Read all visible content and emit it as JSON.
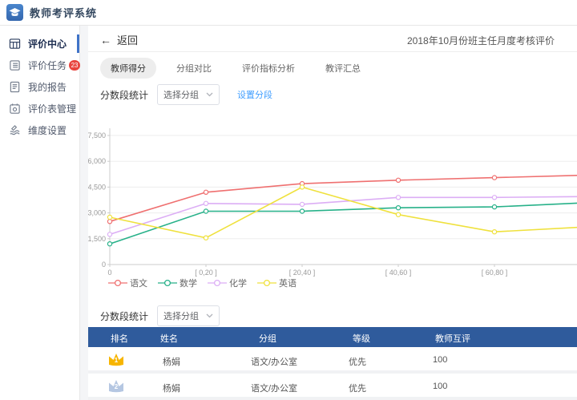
{
  "header": {
    "app_title": "教师考评系统",
    "logo_icon": "graduation-cap-icon"
  },
  "sidebar": {
    "items": [
      {
        "label": "评价中心",
        "icon": "grid-icon",
        "active": true
      },
      {
        "label": "评价任务",
        "icon": "task-list-icon",
        "badge": "23"
      },
      {
        "label": "我的报告",
        "icon": "report-icon"
      },
      {
        "label": "评价表管理",
        "icon": "form-manage-icon"
      },
      {
        "label": "维度设置",
        "icon": "dimension-icon"
      }
    ]
  },
  "toolbar": {
    "back_label": "返回",
    "page_title": "2018年10月份班主任月度考核评价"
  },
  "tabs": [
    {
      "label": "教师得分",
      "active": true
    },
    {
      "label": "分组对比",
      "active": false
    },
    {
      "label": "评价指标分析",
      "active": false
    },
    {
      "label": "教评汇总",
      "active": false
    }
  ],
  "score_section_top": {
    "label": "分数段统计",
    "group_select_value": "选择分组",
    "set_segment_label": "设置分段"
  },
  "score_section_bottom": {
    "label": "分数段统计",
    "group_select_value": "选择分组"
  },
  "chart_data": {
    "type": "line",
    "x_labels": [
      "0",
      "[ 0,20 ]",
      "[ 20,40 ]",
      "[ 40,60 ]",
      "[ 60,80 ]"
    ],
    "y_ticks": [
      "0",
      "1,500",
      "3,000",
      "4,500",
      "6,000",
      "7,500"
    ],
    "ylim": [
      0,
      7500
    ],
    "grid": true,
    "legend_position": "bottom-left",
    "clipped_last_point": true,
    "series": [
      {
        "name": "语文",
        "color": "#ef7070",
        "values": [
          2500,
          4200,
          4700,
          4900,
          5050,
          5200
        ]
      },
      {
        "name": "数学",
        "color": "#27b189",
        "values": [
          1200,
          3100,
          3100,
          3300,
          3350,
          3600
        ]
      },
      {
        "name": "化学",
        "color": "#dcaef5",
        "values": [
          1750,
          3550,
          3500,
          3900,
          3900,
          3950
        ]
      },
      {
        "name": "英语",
        "color": "#efe13d",
        "values": [
          2750,
          1550,
          4500,
          2900,
          1900,
          2200
        ]
      }
    ]
  },
  "table": {
    "headers": [
      "排名",
      "姓名",
      "分组",
      "等级",
      "教师互评"
    ],
    "rows": [
      {
        "rank": "1",
        "rank_color": "#f7b500",
        "name": "杨娟",
        "group": "语文/办公室",
        "grade": "优先",
        "score": "100"
      },
      {
        "rank": "2",
        "rank_color": "#b5c7e2",
        "name": "杨娟",
        "group": "语文/办公室",
        "grade": "优先",
        "score": "100"
      }
    ]
  },
  "colors": {
    "table_header_bg": "#2f5b9c",
    "active_bar": "#3f73c8",
    "badge_bg": "#e8443e",
    "link": "#409eff"
  }
}
